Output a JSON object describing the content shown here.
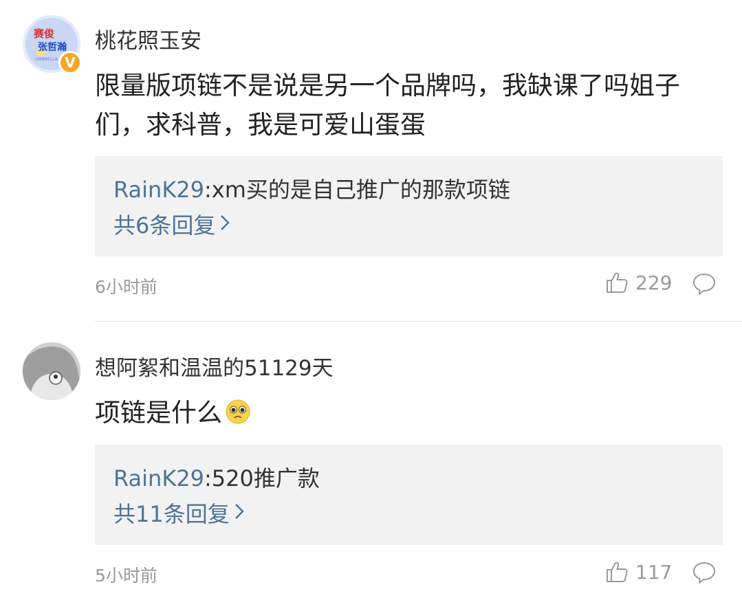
{
  "comments": [
    {
      "username": "桃花照玉安",
      "avatar_text": [
        "赛俊",
        "张哲瀚",
        "UMBRELLA"
      ],
      "verified_badge": "V",
      "content": "限量版项链不是说是另一个品牌吗，我缺课了吗姐子们，求科普，我是可爱山蛋蛋",
      "reply_author": "RainK29",
      "reply_text": ":xm买的是自己推广的那款项链",
      "reply_count_label": "共6条回复",
      "time": "6小时前",
      "likes": "229"
    },
    {
      "username": "想阿絮和温温的51129天",
      "content": "项链是什么",
      "content_emoji": "pleading-face",
      "reply_author": "RainK29",
      "reply_text": ":520推广款",
      "reply_count_label": "共11条回复",
      "time": "5小时前",
      "likes": "117"
    }
  ],
  "colors": {
    "link": "#4e7396",
    "meta": "#999999",
    "reply_bg": "#f2f2f2",
    "badge": "#f5a623"
  }
}
